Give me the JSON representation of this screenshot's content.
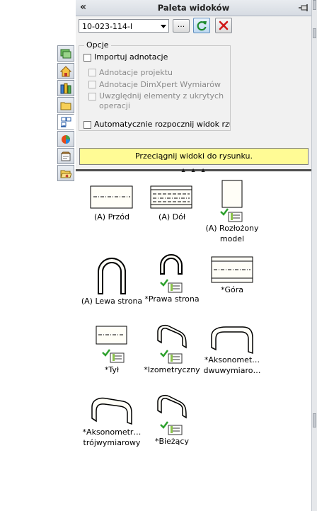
{
  "palette": {
    "title": "Paleta widoków",
    "collapse_symbol": "«",
    "document_select": {
      "value": "10-023-114-I"
    },
    "browse_label": "...",
    "options": {
      "legend": "Opcje",
      "import_annotations": "Importuj adnotacje",
      "design_annotations": "Adnotacje projektu",
      "dimxpert_annotations": "Adnotacje DimXpert Wymiarów",
      "hidden_features": "Uwzględnij elementy z ukrytych operacji",
      "auto_start_projection": "Automatycznie rozpocznij widok rzutowany"
    },
    "hint": "Przeciągnij widoki do rysunku.",
    "views": [
      {
        "label": "(A) Przód"
      },
      {
        "label": "(A) Dół"
      },
      {
        "label": "(A) Rozłożony model"
      },
      {
        "label": "(A) Lewa strona"
      },
      {
        "label": "*Prawa strona"
      },
      {
        "label": "*Góra"
      },
      {
        "label": "*Tył"
      },
      {
        "label": "*Izometryczny"
      },
      {
        "label": "*Aksonomet… dwuwymiaro…"
      },
      {
        "label": "*Aksonometr… trójwymiarowy"
      },
      {
        "label": "*Bieżący"
      }
    ]
  },
  "icons": {
    "side_tabs": [
      "display-manager-icon",
      "home-icon",
      "design-library-icon",
      "file-explorer-icon",
      "view-palette-icon",
      "appearances-icon",
      "custom-properties-icon",
      "folder-open-icon"
    ]
  },
  "colors": {
    "hint_background": "#fffb95",
    "view_fill": "#fffef7",
    "refresh_button": "#bcd8f1",
    "close_x": "#d01818",
    "badge_check": "#2ca02c"
  }
}
